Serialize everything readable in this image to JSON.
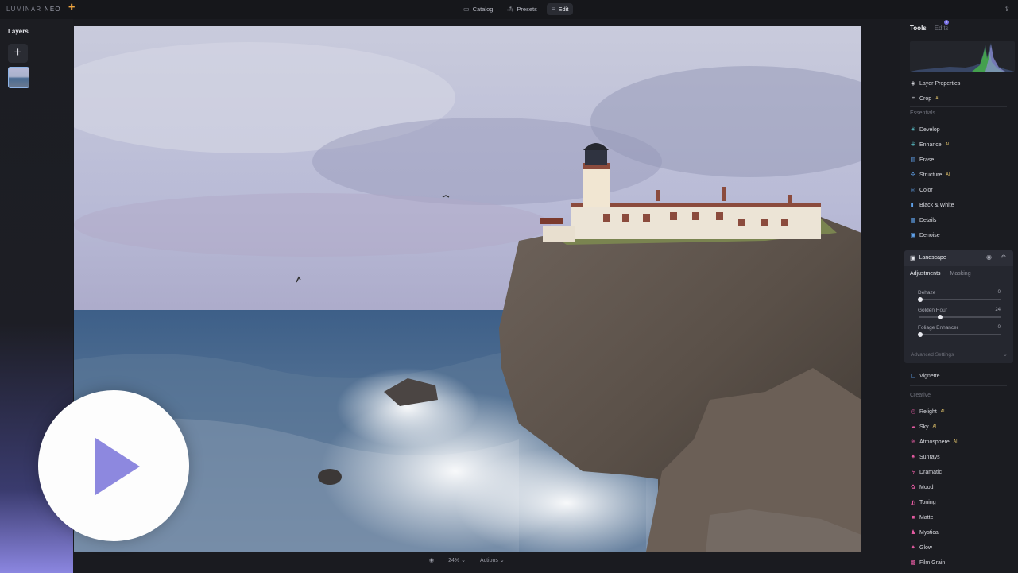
{
  "app": {
    "logo_main": "LUMINAR",
    "logo_sub": "NEO",
    "badge_icon": "puzzle-icon"
  },
  "topnav": [
    {
      "label": "Catalog",
      "icon": "folder-icon",
      "active": false
    },
    {
      "label": "Presets",
      "icon": "presets-icon",
      "active": false
    },
    {
      "label": "Edit",
      "icon": "sliders-icon",
      "active": true
    }
  ],
  "left": {
    "title": "Layers",
    "add_label": "+"
  },
  "right": {
    "tabs": {
      "tools": "Tools",
      "edits": "Edits",
      "edits_count": "2"
    },
    "layer_properties": "Layer Properties",
    "crop": "Crop",
    "essentials_title": "Essentials",
    "essentials": [
      {
        "label": "Develop",
        "icon": "develop-icon",
        "color": "#5fd0d8",
        "ai": false
      },
      {
        "label": "Enhance",
        "icon": "enhance-icon",
        "color": "#5fd0d8",
        "ai": true
      },
      {
        "label": "Erase",
        "icon": "erase-icon",
        "color": "#5f9ee8",
        "ai": false
      },
      {
        "label": "Structure",
        "icon": "structure-icon",
        "color": "#5fa0e8",
        "ai": true
      },
      {
        "label": "Color",
        "icon": "color-icon",
        "color": "#5fa0e8",
        "ai": false
      },
      {
        "label": "Black & White",
        "icon": "bw-icon",
        "color": "#5fa0e8",
        "ai": false
      },
      {
        "label": "Details",
        "icon": "details-icon",
        "color": "#5fa0e8",
        "ai": false
      },
      {
        "label": "Denoise",
        "icon": "denoise-icon",
        "color": "#5fa0e8",
        "ai": false
      }
    ],
    "landscape": {
      "title": "Landscape",
      "tab_adjust": "Adjustments",
      "tab_mask": "Masking",
      "sliders": [
        {
          "label": "Dehaze",
          "value": "0",
          "fraction": 0
        },
        {
          "label": "Golden Hour",
          "value": "24",
          "fraction": 0.24
        },
        {
          "label": "Foliage Enhancer",
          "value": "0",
          "fraction": 0
        }
      ],
      "advanced": "Advanced Settings"
    },
    "vignette": "Vignette",
    "creative_title": "Creative",
    "creative": [
      {
        "label": "Relight",
        "icon": "relight-icon",
        "color": "#e25aa0",
        "ai": true
      },
      {
        "label": "Sky",
        "icon": "sky-icon",
        "color": "#e25aa0",
        "ai": true
      },
      {
        "label": "Atmosphere",
        "icon": "atmosphere-icon",
        "color": "#e25aa0",
        "ai": true
      },
      {
        "label": "Sunrays",
        "icon": "sunrays-icon",
        "color": "#e25aa0",
        "ai": false
      },
      {
        "label": "Dramatic",
        "icon": "dramatic-icon",
        "color": "#e25aa0",
        "ai": false
      },
      {
        "label": "Mood",
        "icon": "mood-icon",
        "color": "#e25aa0",
        "ai": false
      },
      {
        "label": "Toning",
        "icon": "toning-icon",
        "color": "#e25aa0",
        "ai": false
      },
      {
        "label": "Matte",
        "icon": "matte-icon",
        "color": "#e25aa0",
        "ai": false
      },
      {
        "label": "Mystical",
        "icon": "mystical-icon",
        "color": "#e25aa0",
        "ai": false
      },
      {
        "label": "Glow",
        "icon": "glow-icon",
        "color": "#e25aa0",
        "ai": false
      },
      {
        "label": "Film Grain",
        "icon": "film-grain-icon",
        "color": "#e25aa0",
        "ai": false
      }
    ]
  },
  "bottom": {
    "zoom": "24%",
    "actions": "Actions"
  },
  "colors": {
    "accent": "#8d88df",
    "panel": "#1b1c21"
  }
}
